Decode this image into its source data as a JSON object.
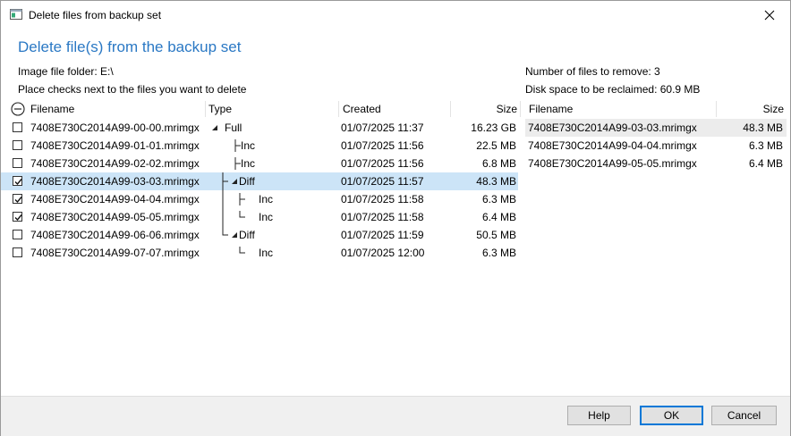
{
  "window": {
    "title": "Delete files from backup set",
    "heading": "Delete file(s) from the backup set"
  },
  "info": {
    "image_folder": "Image file folder: E:\\",
    "instructions": "Place checks next to the files you want to delete",
    "files_to_remove": "Number of files to remove: 3",
    "space_reclaimed": "Disk space to be reclaimed: 60.9 MB"
  },
  "left_list": {
    "columns": {
      "filename": "Filename",
      "type": "Type",
      "created": "Created",
      "size": "Size"
    },
    "rows": [
      {
        "filename": "7408E730C2014A99-00-00.mrimgx",
        "type": "Full",
        "created": "01/07/2025 11:37",
        "size": "16.23 GB",
        "checked": false,
        "selected": false
      },
      {
        "filename": "7408E730C2014A99-01-01.mrimgx",
        "type": "Inc",
        "created": "01/07/2025 11:56",
        "size": "22.5 MB",
        "checked": false,
        "selected": false
      },
      {
        "filename": "7408E730C2014A99-02-02.mrimgx",
        "type": "Inc",
        "created": "01/07/2025 11:56",
        "size": "6.8 MB",
        "checked": false,
        "selected": false
      },
      {
        "filename": "7408E730C2014A99-03-03.mrimgx",
        "type": "Diff",
        "created": "01/07/2025 11:57",
        "size": "48.3 MB",
        "checked": true,
        "selected": true
      },
      {
        "filename": "7408E730C2014A99-04-04.mrimgx",
        "type": "Inc",
        "created": "01/07/2025 11:58",
        "size": "6.3 MB",
        "checked": true,
        "selected": false
      },
      {
        "filename": "7408E730C2014A99-05-05.mrimgx",
        "type": "Inc",
        "created": "01/07/2025 11:58",
        "size": "6.4 MB",
        "checked": true,
        "selected": false
      },
      {
        "filename": "7408E730C2014A99-06-06.mrimgx",
        "type": "Diff",
        "created": "01/07/2025 11:59",
        "size": "50.5 MB",
        "checked": false,
        "selected": false
      },
      {
        "filename": "7408E730C2014A99-07-07.mrimgx",
        "type": "Inc",
        "created": "01/07/2025 12:00",
        "size": "6.3 MB",
        "checked": false,
        "selected": false
      }
    ]
  },
  "right_list": {
    "columns": {
      "filename": "Filename",
      "size": "Size"
    },
    "rows": [
      {
        "filename": "7408E730C2014A99-03-03.mrimgx",
        "size": "48.3 MB"
      },
      {
        "filename": "7408E730C2014A99-04-04.mrimgx",
        "size": "6.3 MB"
      },
      {
        "filename": "7408E730C2014A99-05-05.mrimgx",
        "size": "6.4 MB"
      }
    ]
  },
  "buttons": {
    "help": "Help",
    "ok": "OK",
    "cancel": "Cancel"
  },
  "colors": {
    "accent": "#2a78c4",
    "selection": "#cce4f7",
    "default_button_border": "#0078d7"
  }
}
